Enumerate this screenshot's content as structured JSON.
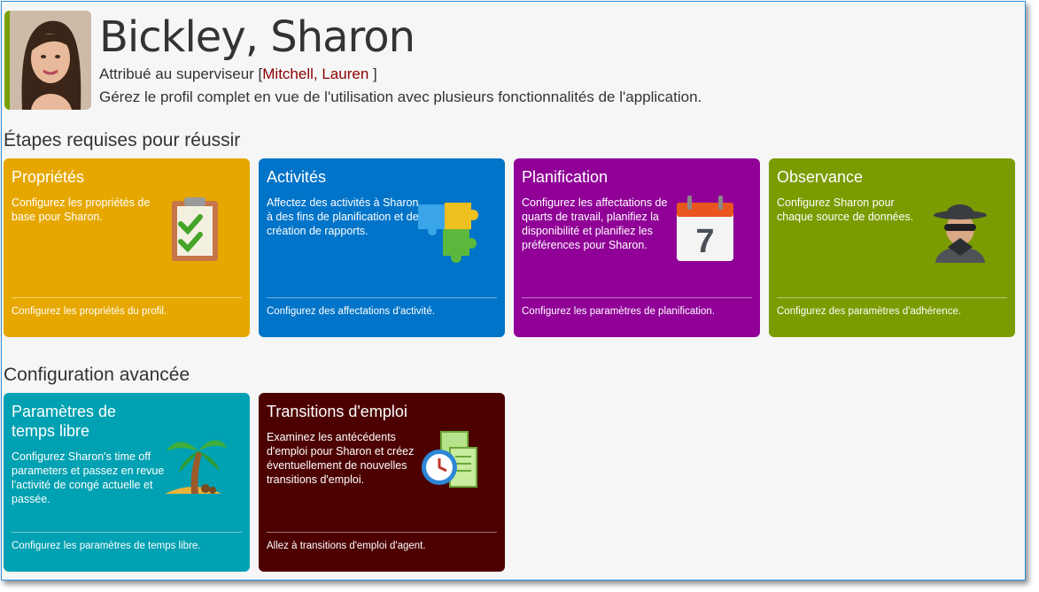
{
  "header": {
    "name": "Bickley, Sharon",
    "assigned_prefix": "Attribué au superviseur [",
    "supervisor": "Mitchell, Lauren",
    "assigned_suffix": " ]",
    "description": "Gérez le profil complet en vue de l'utilisation avec plusieurs fonctionnalités de l'application."
  },
  "sections": {
    "required": "Étapes requises pour réussir",
    "advanced": "Configuration avancée"
  },
  "cards": [
    {
      "title": "Propriétés",
      "text": "Configurez les propriétés de base pour Sharon.",
      "footer": "Configurez les propriétés du profil.",
      "color": "#e6a800",
      "icon": "clipboard-check-icon"
    },
    {
      "title": "Activités",
      "text": "Affectez des activités à Sharon à des fins de planification et de création de rapports.",
      "footer": "Configurez des affectations d'activité.",
      "color": "#0074c8",
      "icon": "puzzle-icon"
    },
    {
      "title": "Planification",
      "text": "Configurez les affectations de quarts de travail, planifiez la disponibilité et planifiez les préférences pour Sharon.",
      "footer": "Configurez les paramètres de planification.",
      "color": "#900097",
      "icon": "calendar-icon"
    },
    {
      "title": "Observance",
      "text": "Configurez Sharon pour chaque source de données.",
      "footer": "Configurez des paramètres d'adhérence.",
      "color": "#7a9c00",
      "icon": "spy-icon"
    },
    {
      "title": "Paramètres de temps libre",
      "text": "Configurez Sharon's time off parameters et passez en revue l'activité de congé actuelle et passée.",
      "footer": "Configurez les paramètres de temps libre.",
      "color": "#00a1b2",
      "icon": "palm-tree-icon"
    },
    {
      "title": "Transitions d'emploi",
      "text": "Examinez les antécédents d'emploi pour Sharon et créez éventuellement de nouvelles transitions d'emploi.",
      "footer": "Allez à transitions d'emploi d'agent.",
      "color": "#4d0000",
      "icon": "clock-documents-icon"
    }
  ],
  "calendar_day": "7"
}
